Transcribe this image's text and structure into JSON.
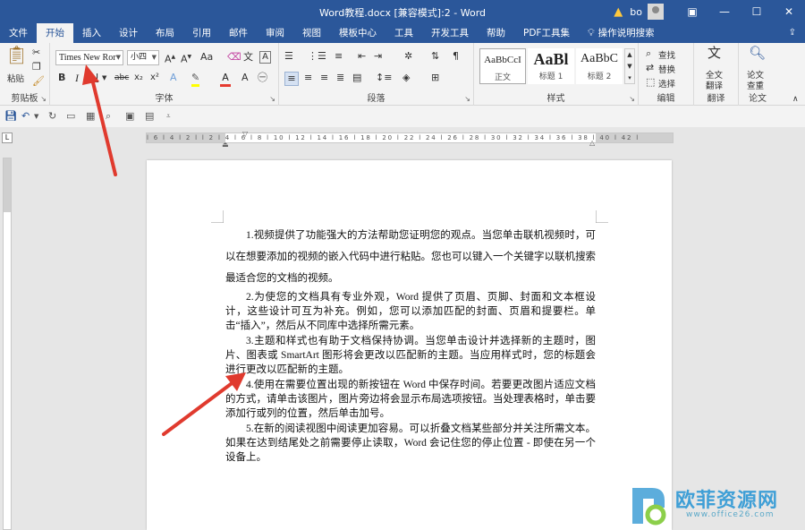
{
  "window": {
    "title": "Word教程.docx [兼容模式]:2 - Word",
    "user": "bo",
    "icons": [
      "warning-icon",
      "ribbon-display-icon",
      "minimize-icon",
      "maximize-icon",
      "close-icon"
    ]
  },
  "tabs": [
    {
      "label": "文件"
    },
    {
      "label": "开始"
    },
    {
      "label": "插入"
    },
    {
      "label": "设计"
    },
    {
      "label": "布局"
    },
    {
      "label": "引用"
    },
    {
      "label": "邮件"
    },
    {
      "label": "审阅"
    },
    {
      "label": "视图"
    },
    {
      "label": "模板中心"
    },
    {
      "label": "工具"
    },
    {
      "label": "开发工具"
    },
    {
      "label": "帮助"
    },
    {
      "label": "PDF工具集"
    },
    {
      "label": "操作说明搜索"
    }
  ],
  "active_tab": "开始",
  "ribbon": {
    "clipboard": {
      "paste": "粘贴",
      "label": "剪贴板"
    },
    "font": {
      "label": "字体",
      "font_name": "Times New Ror",
      "font_size": "小四",
      "buttons": {
        "bold": "B",
        "italic": "I",
        "underline": "U",
        "strike": "abc",
        "sub": "x₂",
        "sup": "x²",
        "aa": "Aa",
        "font_color": "A"
      }
    },
    "paragraph": {
      "label": "段落"
    },
    "styles": {
      "label": "样式",
      "items": [
        {
          "sample": "AaBbCcI",
          "name": "正文"
        },
        {
          "sample": "AaBl",
          "name": "标题 1"
        },
        {
          "sample": "AaBbC",
          "name": "标题 2"
        }
      ]
    },
    "editing": {
      "label": "编辑",
      "find": "查找",
      "replace": "替换",
      "select": "选择"
    },
    "translate": {
      "btn_line1": "全文",
      "btn_line2": "翻译",
      "label": "翻译"
    },
    "paper": {
      "btn_line1": "论文",
      "btn_line2": "查重",
      "label": "论文"
    }
  },
  "ruler": {
    "numbers": "l 6 l 4 l 2 l l 2 l 4 l 6 l 8 l 10 l 12 l 14 l 16 l 18 l 20 l 22 l 24 l 26 l 28 l 30 l 32 l 34 l 36 l 38 l 40 l 42 l"
  },
  "document": {
    "paragraphs": [
      "1.视频提供了功能强大的方法帮助您证明您的观点。当您单击联机视频时，可以在想要添加的视频的嵌入代码中进行粘贴。您也可以键入一个关键字以联机搜索最适合您的文档的视频。",
      "2.为使您的文档具有专业外观，Word 提供了页眉、页脚、封面和文本框设计，这些设计可互为补充。例如，您可以添加匹配的封面、页眉和提要栏。单击“插入”，然后从不同库中选择所需元素。",
      "3.主题和样式也有助于文档保持协调。当您单击设计并选择新的主题时，图片、图表或 SmartArt 图形将会更改以匹配新的主题。当应用样式时，您的标题会进行更改以匹配新的主题。",
      "4.使用在需要位置出现的新按钮在 Word 中保存时间。若要更改图片适应文档的方式，请单击该图片，图片旁边将会显示布局选项按钮。当处理表格时，单击要添加行或列的位置，然后单击加号。",
      "5.在新的阅读视图中阅读更加容易。可以折叠文档某些部分并关注所需文本。如果在达到结尾处之前需要停止读取，Word 会记住您的停止位置 - 即使在另一个设备上。"
    ]
  },
  "watermark": {
    "text": "欧菲资源网",
    "url": "www.office26.com"
  },
  "colors": {
    "accent": "#2b579a",
    "arrow": "#e03a2e",
    "watermark": "#3f9fd6"
  }
}
